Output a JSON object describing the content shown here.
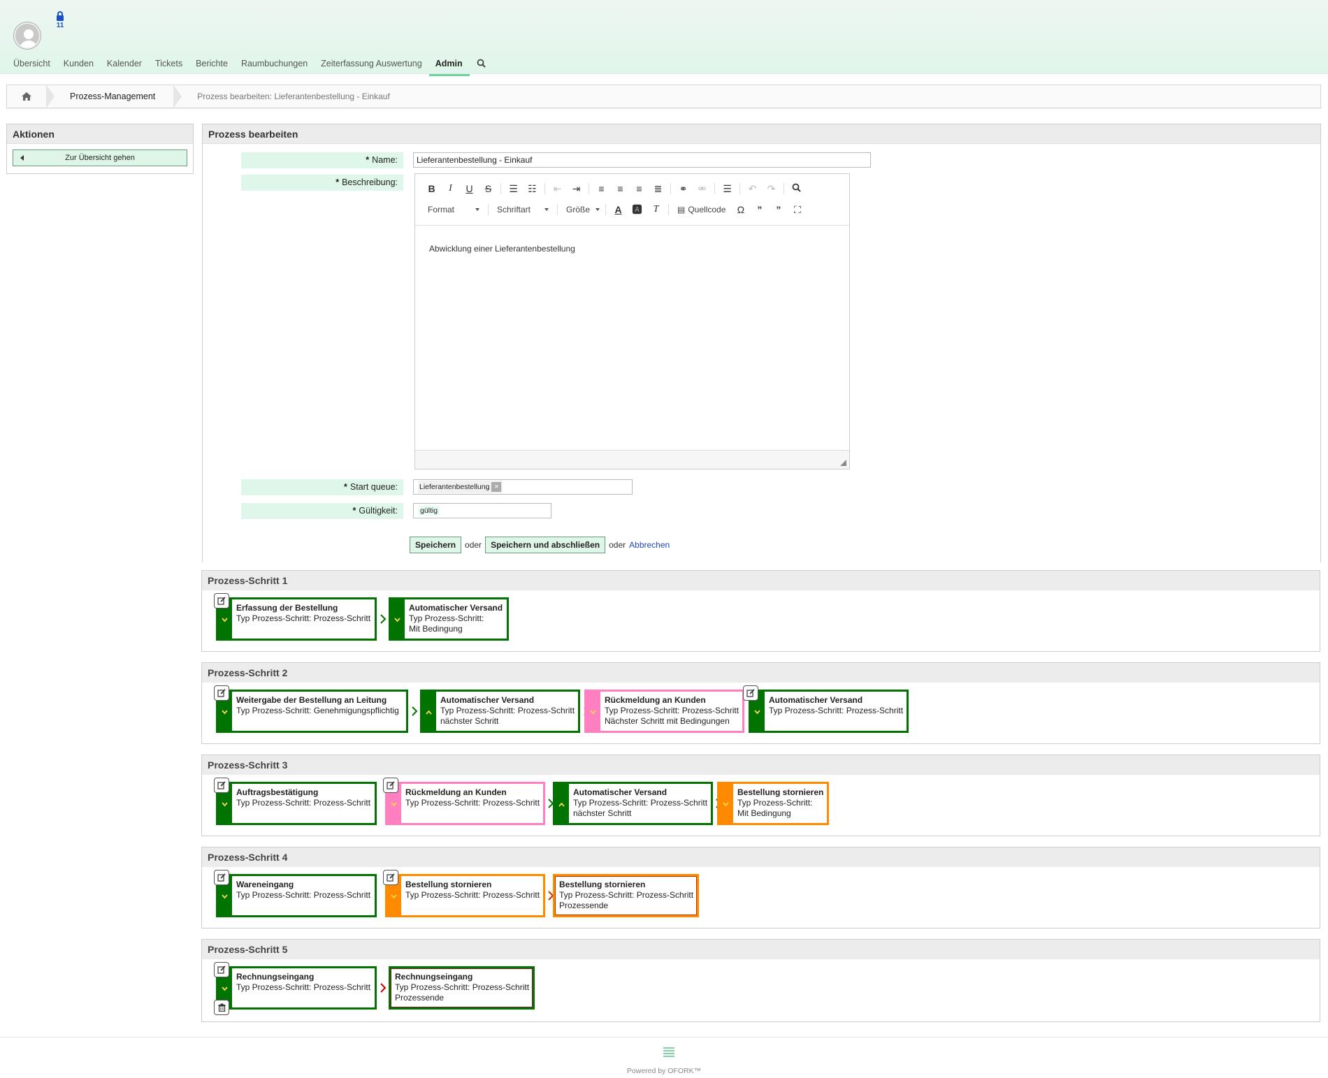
{
  "header": {
    "lock_count": "11",
    "nav": [
      "Übersicht",
      "Kunden",
      "Kalender",
      "Tickets",
      "Berichte",
      "Raumbuchungen",
      "Zeiterfassung Auswertung",
      "Admin"
    ],
    "active_nav": "Admin"
  },
  "breadcrumb": {
    "item1": "Prozess-Management",
    "current": "Prozess bearbeiten: Lieferantenbestellung - Einkauf"
  },
  "sidebar": {
    "title": "Aktionen",
    "button": "Zur Übersicht gehen"
  },
  "form": {
    "title": "Prozess bearbeiten",
    "name_label": "Name:",
    "name_value": "Lieferantenbestellung - Einkauf",
    "desc_label": "Beschreibung:",
    "desc_value": "Abwicklung einer Lieferantenbestellung",
    "toolbar": {
      "format": "Format",
      "font": "Schriftart",
      "size": "Größe",
      "source": "Quellcode"
    },
    "queue_label": "Start queue:",
    "queue_value": "Lieferantenbestellung",
    "validity_label": "Gültigkeit:",
    "validity_value": "gültig",
    "save": "Speichern",
    "or1": "oder",
    "save_close": "Speichern und abschließen",
    "or2": "oder",
    "cancel": "Abbrechen"
  },
  "steps": [
    {
      "title": "Prozess-Schritt 1",
      "cards": [
        {
          "title": "Erfassung der Bestellung",
          "lines": [
            "Typ Prozess-Schritt: Prozess-Schritt"
          ]
        },
        {
          "title": "Automatischer Versand",
          "lines": [
            "Typ Prozess-Schritt:",
            "Mit Bedingung"
          ]
        }
      ]
    },
    {
      "title": "Prozess-Schritt 2",
      "cards": [
        {
          "title": "Weitergabe der Bestellung an Leitung",
          "lines": [
            "Typ Prozess-Schritt: Genehmigungspflichtig"
          ]
        },
        {
          "title": "Automatischer Versand",
          "lines": [
            "Typ Prozess-Schritt: Prozess-Schritt",
            "nächster Schritt"
          ]
        },
        {
          "title": "Rückmeldung an Kunden",
          "lines": [
            "Typ Prozess-Schritt: Prozess-Schritt",
            "Nächster Schritt mit Bedingungen"
          ]
        },
        {
          "title": "Automatischer Versand",
          "lines": [
            "Typ Prozess-Schritt: Prozess-Schritt"
          ]
        }
      ]
    },
    {
      "title": "Prozess-Schritt 3",
      "cards": [
        {
          "title": "Auftragsbestätigung",
          "lines": [
            "Typ Prozess-Schritt: Prozess-Schritt"
          ]
        },
        {
          "title": "Rückmeldung an Kunden",
          "lines": [
            "Typ Prozess-Schritt: Prozess-Schritt"
          ]
        },
        {
          "title": "Automatischer Versand",
          "lines": [
            "Typ Prozess-Schritt: Prozess-Schritt",
            "nächster Schritt"
          ]
        },
        {
          "title": "Bestellung stornieren",
          "lines": [
            "Typ Prozess-Schritt:",
            "Mit Bedingung"
          ]
        }
      ]
    },
    {
      "title": "Prozess-Schritt 4",
      "cards": [
        {
          "title": "Wareneingang",
          "lines": [
            "Typ Prozess-Schritt: Prozess-Schritt"
          ]
        },
        {
          "title": "Bestellung stornieren",
          "lines": [
            "Typ Prozess-Schritt: Prozess-Schritt"
          ]
        },
        {
          "title": "Bestellung stornieren",
          "lines": [
            "Typ Prozess-Schritt: Prozess-Schritt",
            "Prozessende"
          ]
        }
      ]
    },
    {
      "title": "Prozess-Schritt 5",
      "cards": [
        {
          "title": "Rechnungseingang",
          "lines": [
            "Typ Prozess-Schritt: Prozess-Schritt"
          ]
        },
        {
          "title": "Rechnungseingang",
          "lines": [
            "Typ Prozess-Schritt: Prozess-Schritt",
            "Prozessende"
          ]
        }
      ]
    }
  ],
  "footer": {
    "text": "Powered by OFORK™"
  },
  "colors": {
    "green": "#007300",
    "pink": "#ff7fc1",
    "orange": "#ff8a00",
    "accent": "#def5e8"
  }
}
